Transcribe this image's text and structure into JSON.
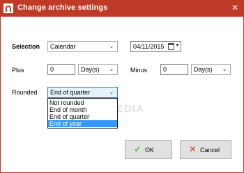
{
  "window": {
    "title": "Change archive settings",
    "close_glyph": "✕",
    "accent_color": "#bf3a27"
  },
  "selection": {
    "label": "Selection",
    "value": "Calendar",
    "date_value": "04/11/2015"
  },
  "plus": {
    "label": "Plus",
    "number": "0",
    "unit": "Day(s)"
  },
  "minus": {
    "label": "Minus",
    "number": "0",
    "unit": "Day(s)"
  },
  "rounded": {
    "label": "Rounded",
    "value": "End of quarter",
    "options": [
      "Not rounded",
      "End of month",
      "End of quarter",
      "End of year"
    ],
    "highlighted_option": "End of year"
  },
  "watermark": "SOFTPEDIA",
  "buttons": {
    "ok": {
      "label": "OK",
      "icon": "check-icon",
      "icon_color": "#2e9c2e"
    },
    "cancel": {
      "label": "Cancel",
      "icon": "x-icon",
      "icon_color": "#d83b2b"
    }
  },
  "glyphs": {
    "chevron": "⌄",
    "check": "✓",
    "cross": "✕"
  }
}
